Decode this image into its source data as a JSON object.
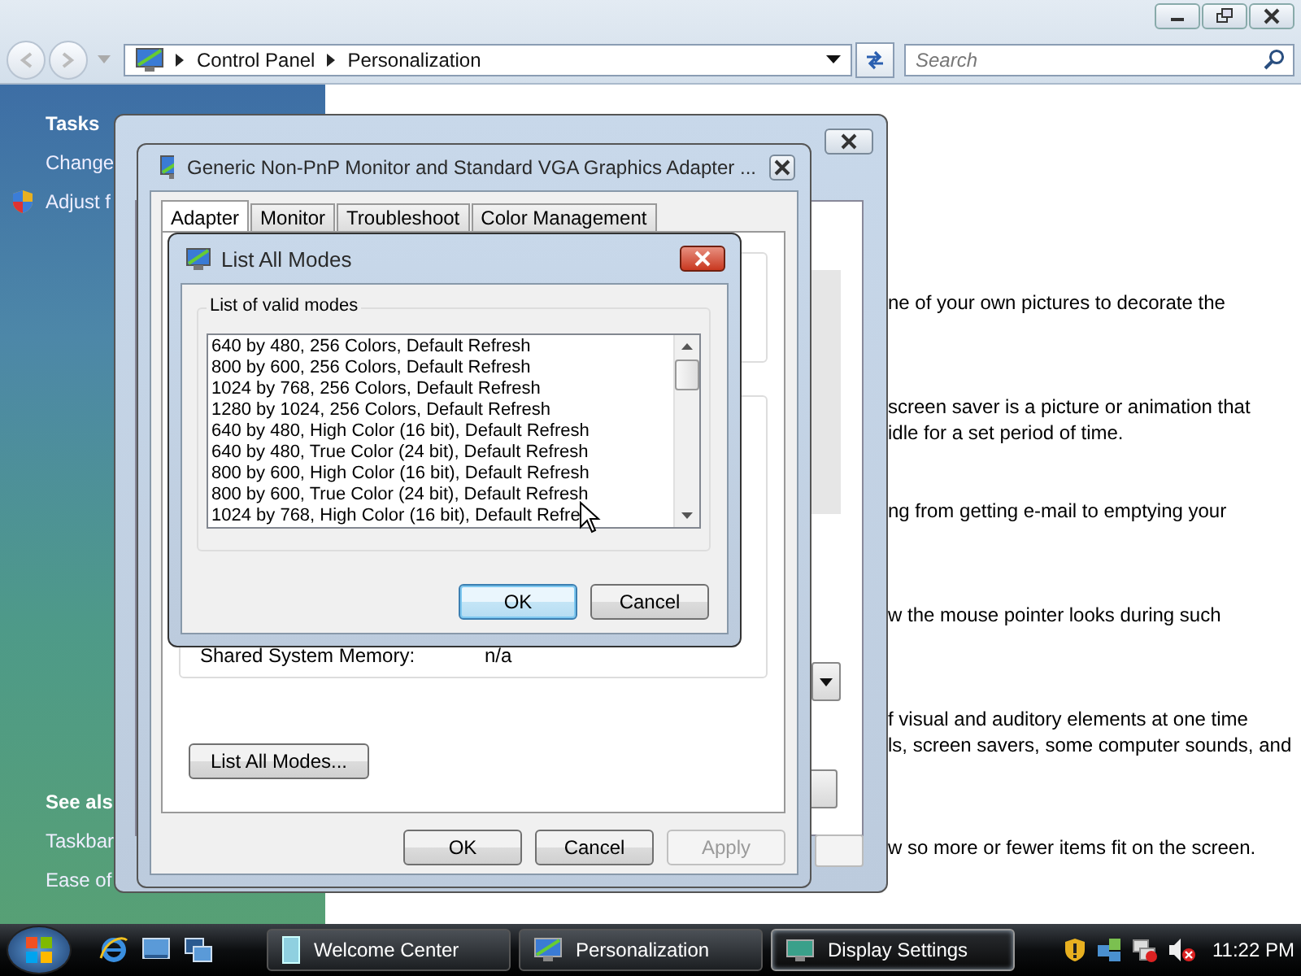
{
  "address": {
    "path": [
      "Control Panel",
      "Personalization"
    ]
  },
  "search": {
    "placeholder": "Search"
  },
  "sidebar": {
    "sections": [
      {
        "heading": "Tasks",
        "items": [
          {
            "label": "Change",
            "kind": "plain"
          },
          {
            "label": "Adjust f",
            "kind": "shield"
          }
        ]
      },
      {
        "heading": "See als",
        "items": [
          {
            "label": "Taskbar",
            "kind": "plain"
          },
          {
            "label": "Ease of",
            "kind": "plain"
          }
        ]
      }
    ]
  },
  "content": {
    "blocks": [
      {
        "lines": [
          "ne of your own pictures to decorate the"
        ]
      },
      {
        "lines": [
          "screen saver is a picture or animation that",
          "idle for a set period of time."
        ]
      },
      {
        "lines": [
          "ng from getting e-mail to emptying your"
        ]
      },
      {
        "lines": [
          "w the mouse pointer looks during such"
        ]
      },
      {
        "lines": [
          "f visual and auditory elements at one time",
          "ls, screen savers, some computer sounds, and"
        ]
      },
      {
        "lines": [
          "w so more or fewer items fit on the screen."
        ]
      }
    ]
  },
  "adapter_dialog": {
    "title": "Generic Non-PnP Monitor and Standard VGA Graphics Adapter ...",
    "tabs": [
      {
        "label": "Adapter",
        "selected": true
      },
      {
        "label": "Monitor",
        "selected": false
      },
      {
        "label": "Troubleshoot",
        "selected": false
      },
      {
        "label": "Color Management",
        "selected": false
      }
    ],
    "info": [
      {
        "label": "Shared System Memory:",
        "value": "n/a"
      }
    ],
    "list_button": "List All Modes...",
    "buttons": [
      {
        "label": "OK",
        "disabled": false
      },
      {
        "label": "Cancel",
        "disabled": false
      },
      {
        "label": "Apply",
        "disabled": true
      }
    ]
  },
  "modes_dialog": {
    "title": "List All Modes",
    "group_label": "List of valid modes",
    "modes": [
      "640 by 480, 256 Colors, Default Refresh",
      "800 by 600, 256 Colors, Default Refresh",
      "1024 by 768, 256 Colors, Default Refresh",
      "1280 by 1024, 256 Colors, Default Refresh",
      "640 by 480, High Color (16 bit), Default Refresh",
      "640 by 480, True Color (24 bit), Default Refresh",
      "800 by 600, High Color (16 bit), Default Refresh",
      "800 by 600, True Color (24 bit), Default Refresh",
      "1024 by 768, High Color (16 bit), Default Refre"
    ],
    "buttons": [
      {
        "label": "OK",
        "default": true
      },
      {
        "label": "Cancel",
        "default": false
      }
    ]
  },
  "taskbar": {
    "tasks": [
      {
        "label": "Welcome Center",
        "kind": "welcome",
        "selected": false
      },
      {
        "label": "Personalization",
        "kind": "monitor",
        "selected": false
      },
      {
        "label": "Display Settings",
        "kind": "display",
        "selected": true
      }
    ],
    "clock": "11:22 PM"
  }
}
